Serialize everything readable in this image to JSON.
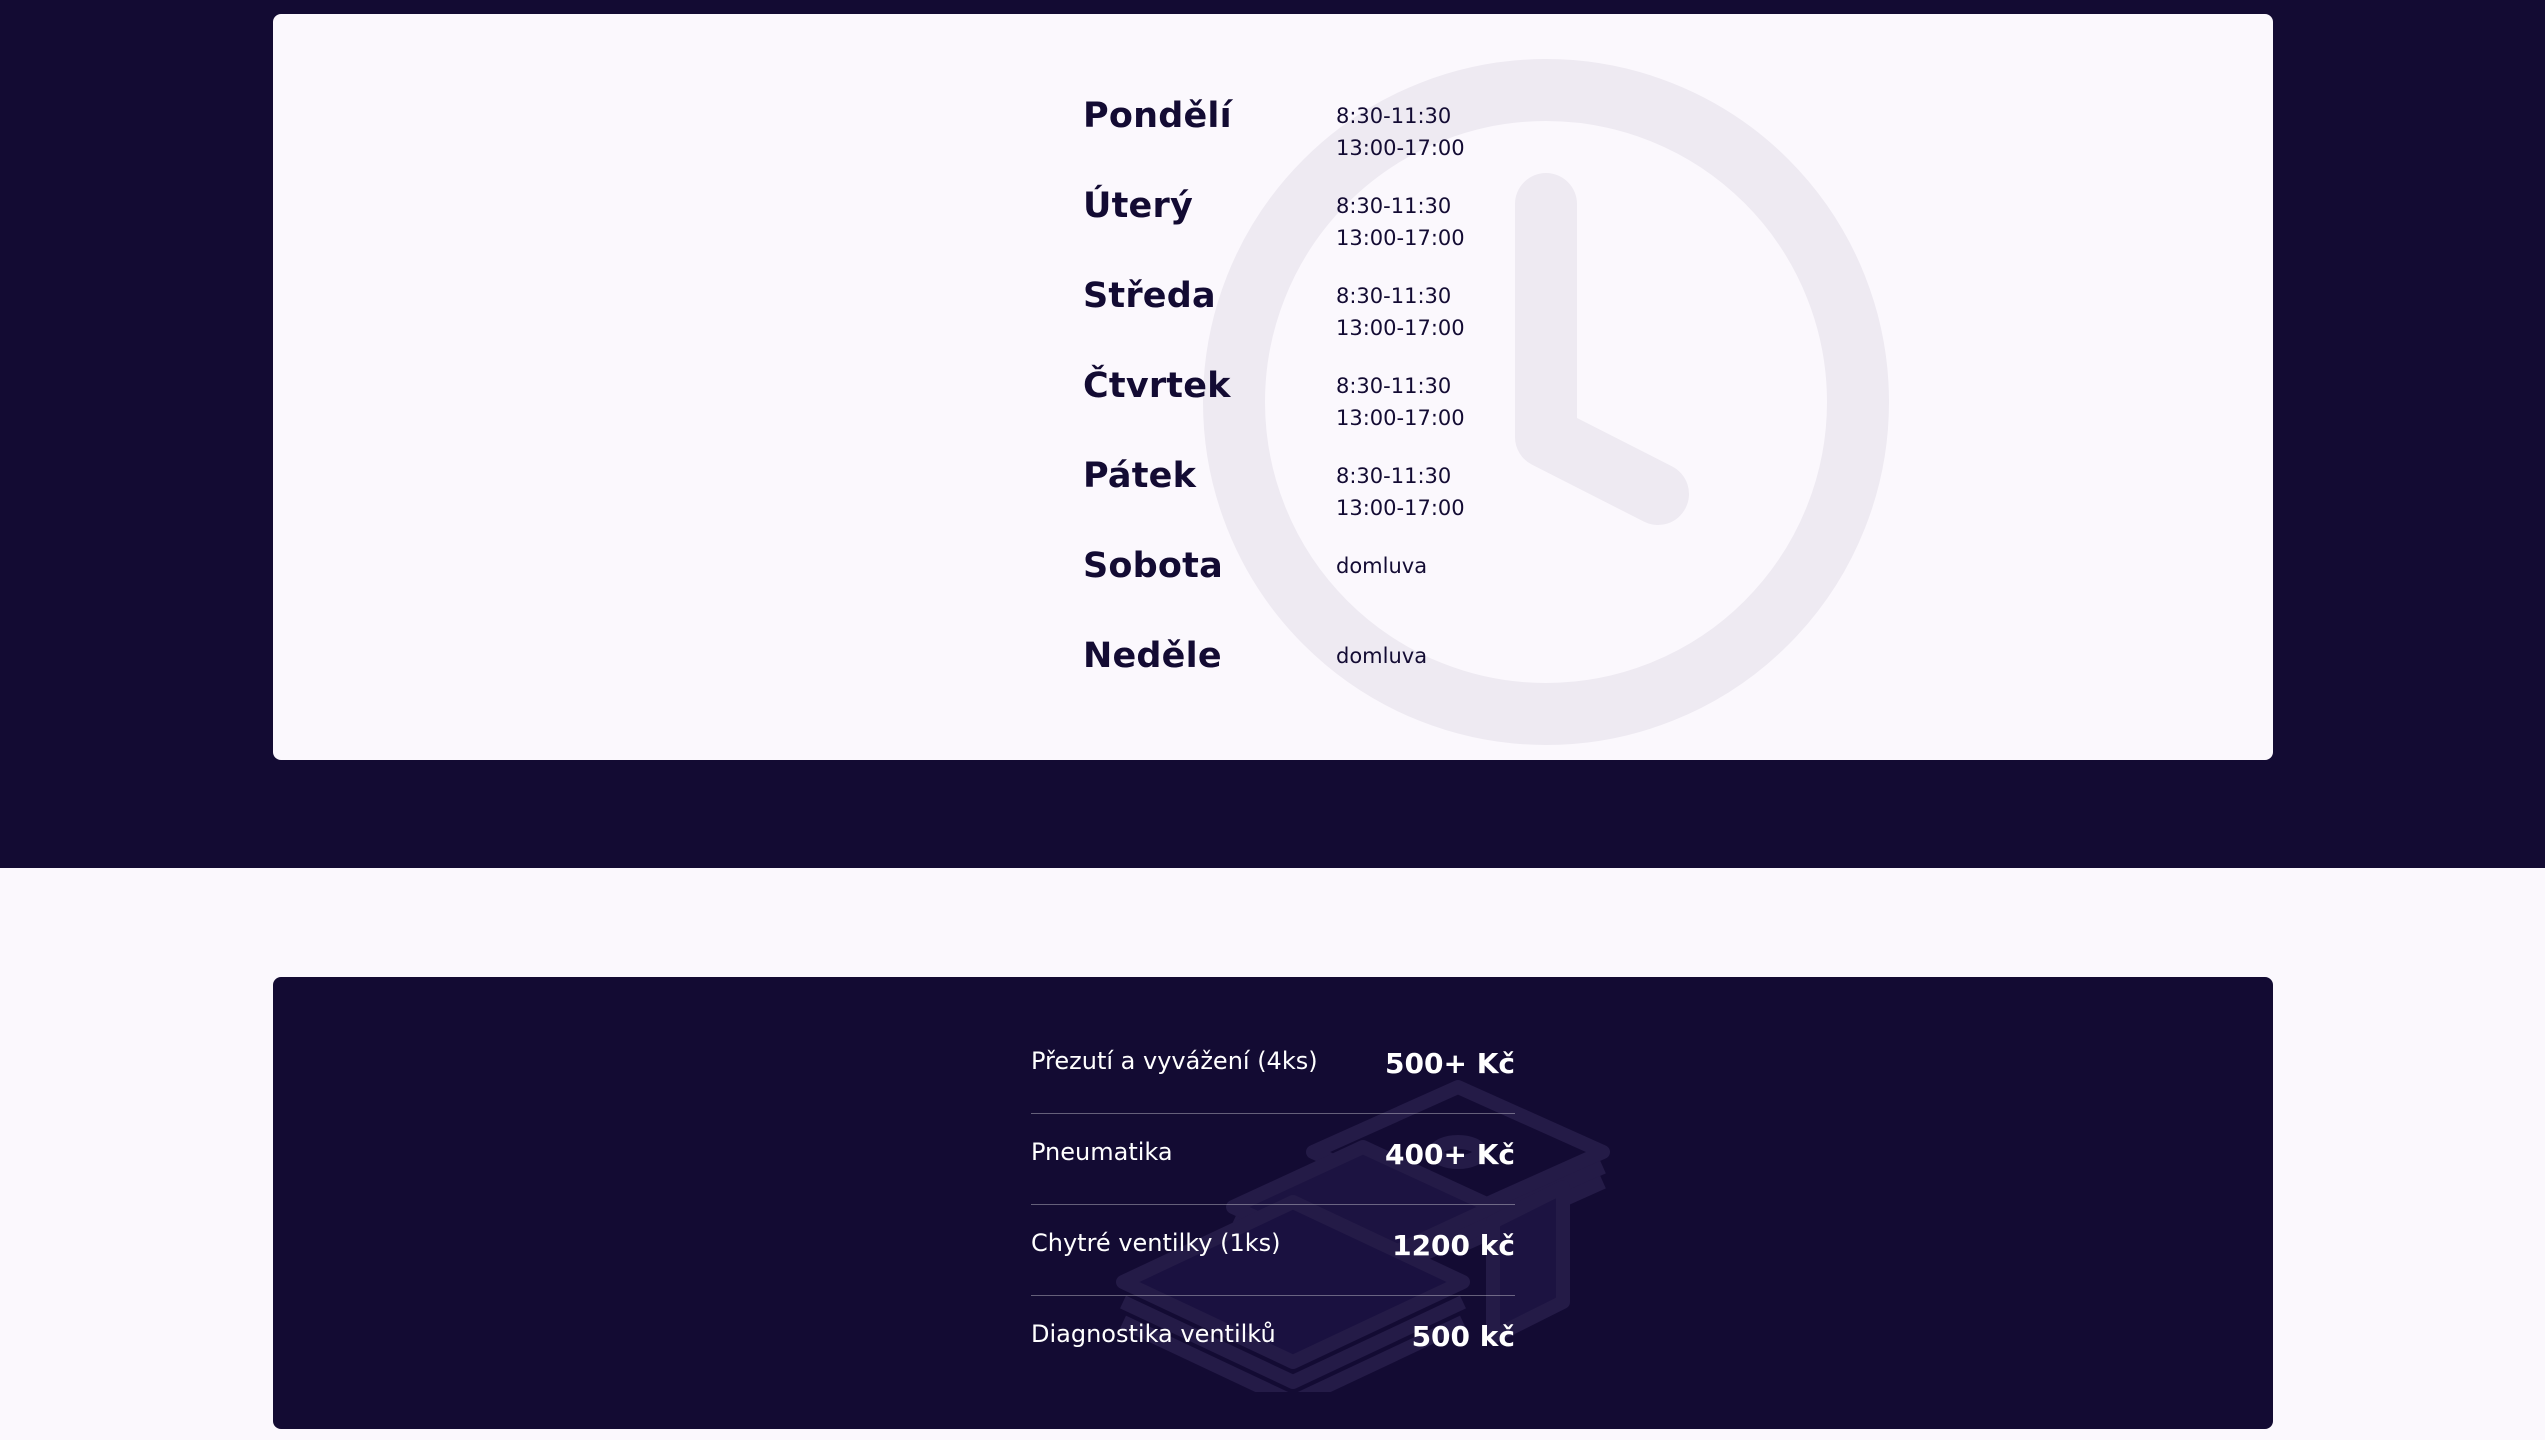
{
  "opening_hours": {
    "days": [
      {
        "name": "Pondělí",
        "times": [
          "8:30-11:30",
          "13:00-17:00"
        ]
      },
      {
        "name": "Úterý",
        "times": [
          "8:30-11:30",
          "13:00-17:00"
        ]
      },
      {
        "name": "Středa",
        "times": [
          "8:30-11:30",
          "13:00-17:00"
        ]
      },
      {
        "name": "Čtvrtek",
        "times": [
          "8:30-11:30",
          "13:00-17:00"
        ]
      },
      {
        "name": "Pátek",
        "times": [
          "8:30-11:30",
          "13:00-17:00"
        ]
      },
      {
        "name": "Sobota",
        "times": [
          "domluva"
        ]
      },
      {
        "name": "Neděle",
        "times": [
          "domluva"
        ]
      }
    ],
    "background_icon": "clock-icon"
  },
  "pricing": {
    "items": [
      {
        "name": "Přezutí a vyvážení (4ks)",
        "price": "500+ Kč"
      },
      {
        "name": "Pneumatika",
        "price": "400+ Kč"
      },
      {
        "name": "Chytré ventilky (1ks)",
        "price": "1200 kč"
      },
      {
        "name": "Diagnostika ventilků",
        "price": "500 kč"
      }
    ],
    "background_icon": "money-stack-icon"
  },
  "colors": {
    "dark": "#130b33",
    "light": "#fbf8fd",
    "clock_tint": "#eeeaf2"
  }
}
